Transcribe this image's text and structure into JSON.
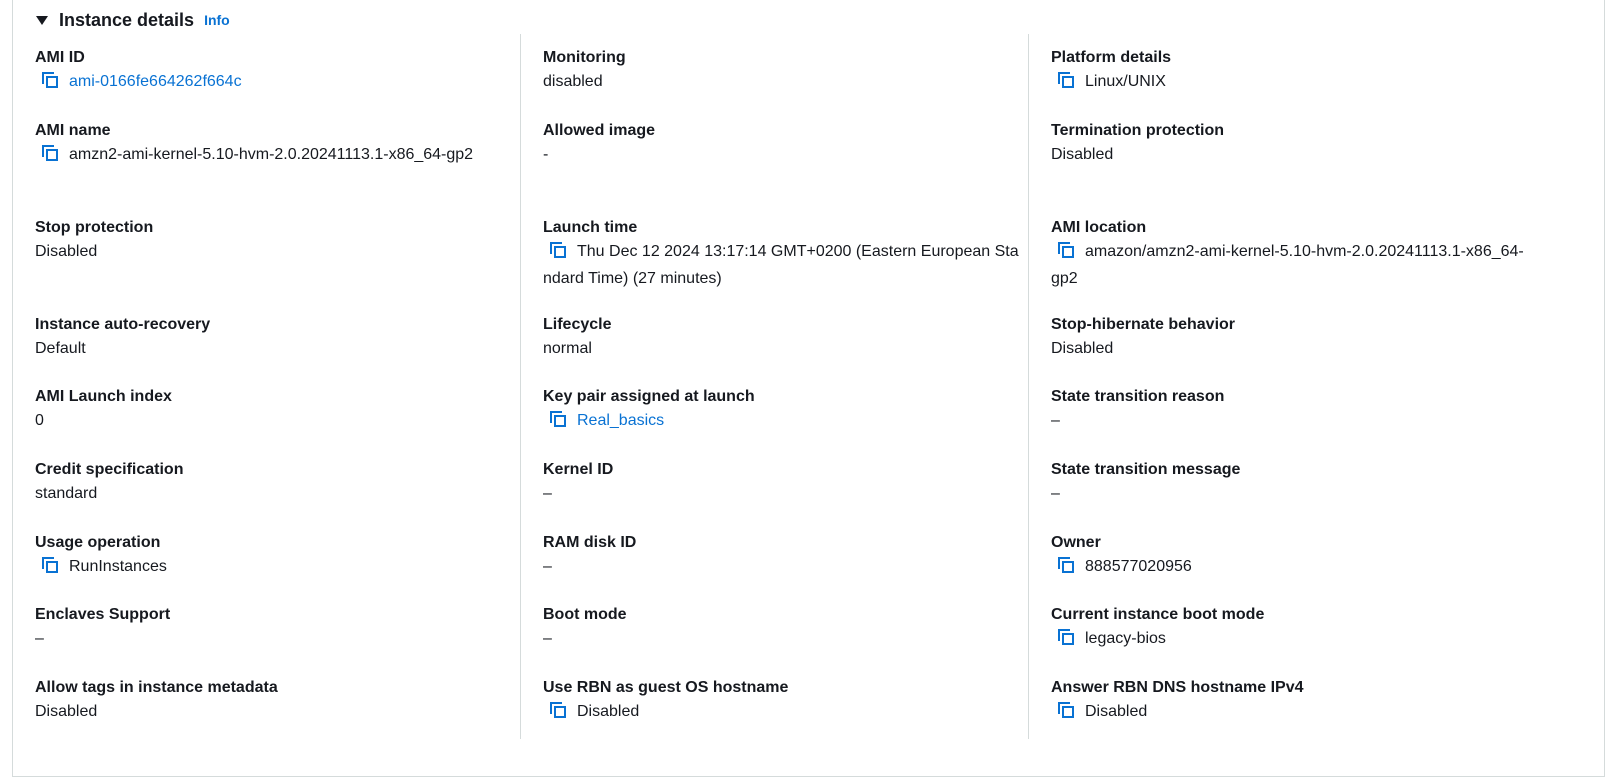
{
  "section": {
    "title": "Instance details",
    "info_label": "Info"
  },
  "columns": [
    [
      {
        "label": "AMI ID",
        "value": "ami-0166fe664262f664c",
        "copy": true,
        "link": true
      },
      {
        "label": "AMI name",
        "value": "amzn2-ami-kernel-5.10-hvm-2.0.20241113.1-x86_64-gp2",
        "copy": true,
        "link": false
      },
      {
        "label": "Stop protection",
        "value": "Disabled",
        "copy": false,
        "link": false
      },
      {
        "label": "Instance auto-recovery",
        "value": "Default",
        "copy": false,
        "link": false
      },
      {
        "label": "AMI Launch index",
        "value": "0",
        "copy": false,
        "link": false
      },
      {
        "label": "Credit specification",
        "value": "standard",
        "copy": false,
        "link": false
      },
      {
        "label": "Usage operation",
        "value": "RunInstances",
        "copy": true,
        "link": false
      },
      {
        "label": "Enclaves Support",
        "value": "–",
        "copy": false,
        "link": false
      },
      {
        "label": "Allow tags in instance metadata",
        "value": "Disabled",
        "copy": false,
        "link": false
      }
    ],
    [
      {
        "label": "Monitoring",
        "value": "disabled",
        "copy": false,
        "link": false
      },
      {
        "label": "Allowed image",
        "value": "-",
        "copy": false,
        "link": false
      },
      {
        "label": "Launch time",
        "value": "Thu Dec 12 2024 13:17:14 GMT+0200 (Eastern European Standard Time) (27 minutes)",
        "copy": true,
        "link": false
      },
      {
        "label": "Lifecycle",
        "value": "normal",
        "copy": false,
        "link": false
      },
      {
        "label": "Key pair assigned at launch",
        "value": "Real_basics",
        "copy": true,
        "link": true
      },
      {
        "label": "Kernel ID",
        "value": "–",
        "copy": false,
        "link": false
      },
      {
        "label": "RAM disk ID",
        "value": "–",
        "copy": false,
        "link": false
      },
      {
        "label": "Boot mode",
        "value": "–",
        "copy": false,
        "link": false
      },
      {
        "label": "Use RBN as guest OS hostname",
        "value": "Disabled",
        "copy": true,
        "link": false
      }
    ],
    [
      {
        "label": "Platform details",
        "value": "Linux/UNIX",
        "copy": true,
        "link": false
      },
      {
        "label": "Termination protection",
        "value": "Disabled",
        "copy": false,
        "link": false
      },
      {
        "label": "AMI location",
        "value": "amazon/amzn2-ami-kernel-5.10-hvm-2.0.20241113.1-x86_64-gp2",
        "copy": true,
        "link": false
      },
      {
        "label": "Stop-hibernate behavior",
        "value": "Disabled",
        "copy": false,
        "link": false
      },
      {
        "label": "State transition reason",
        "value": "–",
        "copy": false,
        "link": false
      },
      {
        "label": "State transition message",
        "value": "–",
        "copy": false,
        "link": false
      },
      {
        "label": "Owner",
        "value": "888577020956",
        "copy": true,
        "link": false
      },
      {
        "label": "Current instance boot mode",
        "value": "legacy-bios",
        "copy": true,
        "link": false
      },
      {
        "label": "Answer RBN DNS hostname IPv4",
        "value": "Disabled",
        "copy": true,
        "link": false
      }
    ]
  ],
  "colors": {
    "text": "#16191f",
    "link": "#0972d3",
    "divider": "#d5dbdb"
  },
  "icons": {
    "caret": "caret-down-icon",
    "copy": "copy-icon"
  }
}
